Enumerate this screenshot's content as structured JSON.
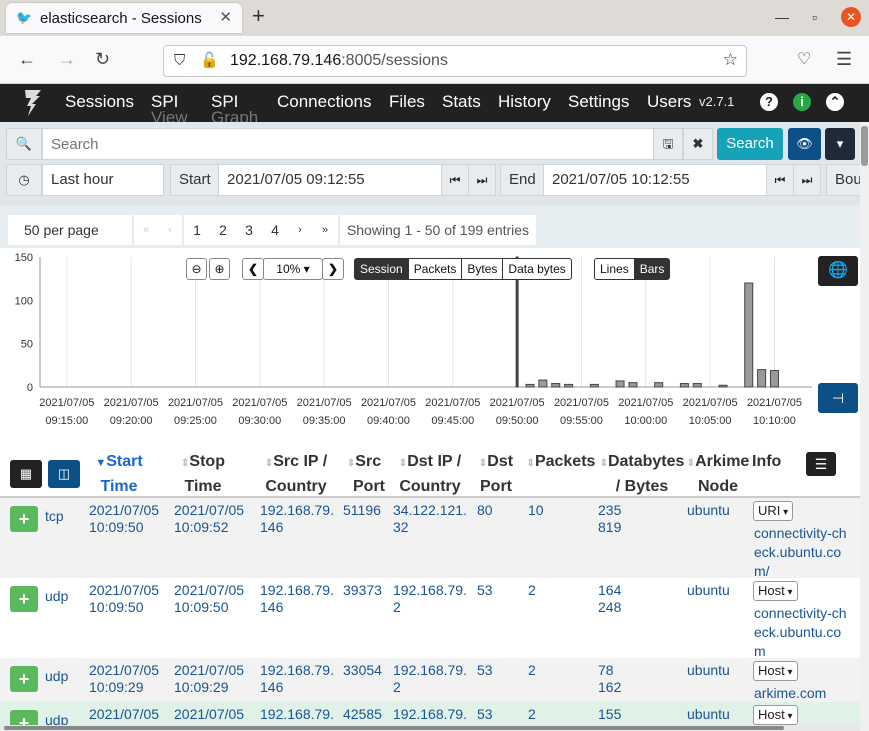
{
  "browser": {
    "tab_title": "elasticsearch - Sessions",
    "url_host": "192.168.79.146",
    "url_rest": ":8005/sessions"
  },
  "appnav": {
    "items": [
      "Sessions",
      "SPI View",
      "SPI Graph",
      "Connections",
      "Files",
      "Stats",
      "History",
      "Settings",
      "Users"
    ],
    "spi_view_1": "SPI",
    "spi_view_2": "View",
    "spi_graph_1": "SPI",
    "spi_graph_2": "Graph",
    "version": "v2.7.1"
  },
  "search": {
    "placeholder": "Search",
    "search_button": "Search"
  },
  "time": {
    "range": "Last hour",
    "start_label": "Start",
    "start_value": "2021/07/05 09:12:55",
    "end_label": "End",
    "end_value": "2021/07/05 10:12:55",
    "bounding": "Bou"
  },
  "paging": {
    "per_page": "50 per page",
    "first": "«",
    "prev": "‹",
    "pages": [
      "1",
      "2",
      "3",
      "4"
    ],
    "next": "›",
    "last": "»",
    "showing": "Showing 1 - 50 of 199 entries"
  },
  "chart_controls": {
    "zoom": "10%",
    "types": [
      "Session",
      "Packets",
      "Bytes",
      "Data bytes"
    ],
    "selected_type": "Session",
    "styles": [
      "Lines",
      "Bars"
    ],
    "selected_style": "Bars"
  },
  "chart_data": {
    "type": "bar",
    "ylim": [
      0,
      150
    ],
    "yticks": [
      "150",
      "100",
      "50",
      "0"
    ],
    "xtick_dates": [
      "2021/07/05",
      "2021/07/05",
      "2021/07/05",
      "2021/07/05",
      "2021/07/05",
      "2021/07/05",
      "2021/07/05",
      "2021/07/05",
      "2021/07/05",
      "2021/07/05",
      "2021/07/05",
      "2021/07/05"
    ],
    "xtick_times": [
      "09:15:00",
      "09:20:00",
      "09:25:00",
      "09:30:00",
      "09:35:00",
      "09:40:00",
      "09:45:00",
      "09:50:00",
      "09:55:00",
      "10:00:00",
      "10:05:00",
      "10:10:00"
    ],
    "bars": [
      {
        "t": "09:50:00",
        "v": 150
      },
      {
        "t": "09:51:00",
        "v": 3
      },
      {
        "t": "09:52:00",
        "v": 8
      },
      {
        "t": "09:53:00",
        "v": 4
      },
      {
        "t": "09:54:00",
        "v": 3
      },
      {
        "t": "09:56:00",
        "v": 3
      },
      {
        "t": "09:58:00",
        "v": 7
      },
      {
        "t": "09:59:00",
        "v": 5
      },
      {
        "t": "10:01:00",
        "v": 5
      },
      {
        "t": "10:03:00",
        "v": 4
      },
      {
        "t": "10:04:00",
        "v": 4
      },
      {
        "t": "10:06:00",
        "v": 2
      },
      {
        "t": "10:08:00",
        "v": 120
      },
      {
        "t": "10:09:00",
        "v": 20
      },
      {
        "t": "10:10:00",
        "v": 19
      }
    ]
  },
  "table": {
    "columns": [
      {
        "l1": "Start",
        "l2": "Time"
      },
      {
        "l1": "Stop",
        "l2": "Time"
      },
      {
        "l1": "Src IP /",
        "l2": "Country"
      },
      {
        "l1": "Src",
        "l2": "Port"
      },
      {
        "l1": "Dst IP /",
        "l2": "Country"
      },
      {
        "l1": "Dst",
        "l2": "Port"
      },
      {
        "l1": "Packets",
        "l2": ""
      },
      {
        "l1": "Databytes",
        "l2": "/ Bytes"
      },
      {
        "l1": "Arkime",
        "l2": "Node"
      },
      {
        "l1": "Info",
        "l2": ""
      }
    ],
    "rows": [
      {
        "proto": "tcp",
        "start1": "2021/07/05",
        "start2": "10:09:50",
        "stop1": "2021/07/05",
        "stop2": "10:09:52",
        "src1": "192.168.79.",
        "src2": "146",
        "sport": "51196",
        "dst1": "34.122.121.",
        "dst2": "32",
        "dport": "80",
        "packets": "10",
        "db1": "235",
        "db2": "819",
        "node": "ubuntu",
        "info_label": "URI",
        "info": [
          "connectivity-ch",
          "eck.ubuntu.co",
          "m/"
        ]
      },
      {
        "proto": "udp",
        "start1": "2021/07/05",
        "start2": "10:09:50",
        "stop1": "2021/07/05",
        "stop2": "10:09:50",
        "src1": "192.168.79.",
        "src2": "146",
        "sport": "39373",
        "dst1": "192.168.79.",
        "dst2": "2",
        "dport": "53",
        "packets": "2",
        "db1": "164",
        "db2": "248",
        "node": "ubuntu",
        "info_label": "Host",
        "info": [
          "connectivity-ch",
          "eck.ubuntu.co",
          "m"
        ]
      },
      {
        "proto": "udp",
        "start1": "2021/07/05",
        "start2": "10:09:29",
        "stop1": "2021/07/05",
        "stop2": "10:09:29",
        "src1": "192.168.79.",
        "src2": "146",
        "sport": "33054",
        "dst1": "192.168.79.",
        "dst2": "2",
        "dport": "53",
        "packets": "2",
        "db1": "78",
        "db2": "162",
        "node": "ubuntu",
        "info_label": "Host",
        "info": [
          "arkime.com"
        ]
      },
      {
        "proto": "udp",
        "start1": "2021/07/05",
        "start2": "",
        "stop1": "2021/07/05",
        "stop2": "",
        "src1": "192.168.79.",
        "src2": "",
        "sport": "42585",
        "dst1": "192.168.79.",
        "dst2": "",
        "dport": "53",
        "packets": "2",
        "db1": "155",
        "db2": "",
        "node": "ubuntu",
        "info_label": "Host",
        "info": []
      }
    ]
  }
}
